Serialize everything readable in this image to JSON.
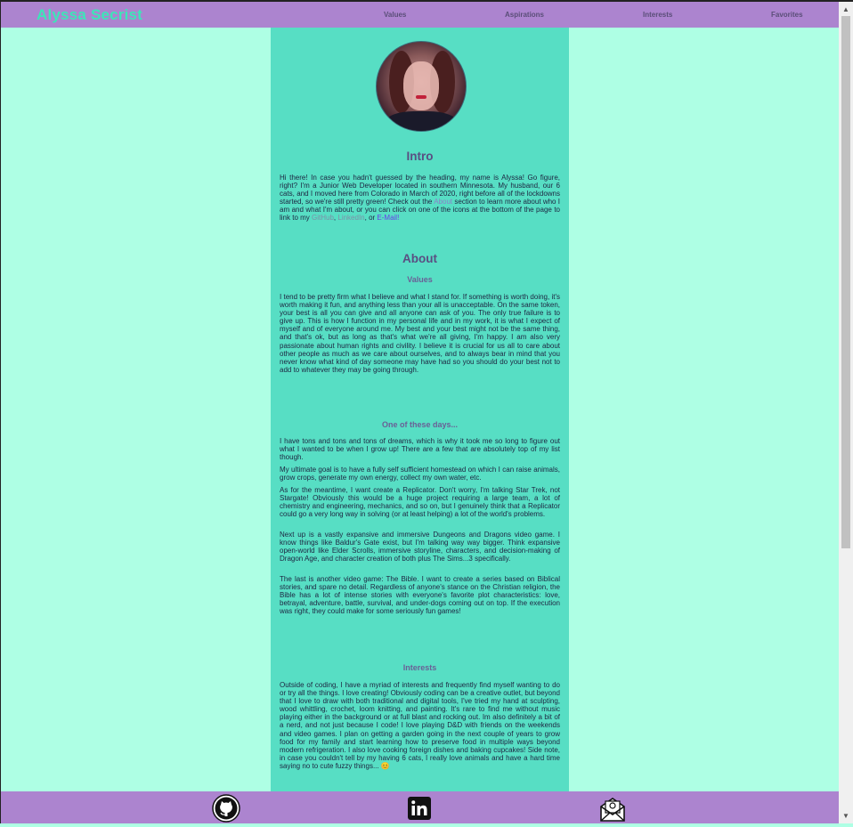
{
  "brand": "Alyssa Secrist",
  "nav": [
    "Values",
    "Aspirations",
    "Interests",
    "Favorites"
  ],
  "intro": {
    "title": "Intro",
    "p1": "Hi there! In case you hadn't guessed by the heading, my name is Alyssa! Go figure, right? I'm a Junior Web Developer located in southern Minnesota. My husband, our 6 cats, and I moved here from Colorado in March of 2020, right before all of the lockdowns started, so we're still pretty green! Check out the ",
    "about_link": "About",
    "p2": " section to learn more about who I am and what I'm about, or you can click on one of the icons at the bottom of the page to link to my ",
    "github_link": "GitHub",
    "comma": ", ",
    "linkedin_link": "LinkedIn",
    "or": ", or ",
    "email_link": "E-Mail!"
  },
  "about": {
    "title": "About",
    "values_title": "Values",
    "values_text": "I tend to be pretty firm what I believe and what I stand for. If something is worth doing, it's worth making it fun, and anything less than your all is unacceptable. On the same token, your best is all you can give and all anyone can ask of you. The only true failure is to give up. This is how I function in my personal life and in my work, it is what I expect of myself and of everyone around me. My best and your best might not be the same thing, and that's ok, but as long as that's what we're all giving, I'm happy. I am also very passionate about human rights and civility. I believe it is crucial for us all to care about other people as much as we care about ourselves, and to always bear in mind that you never know what kind of day someone may have had so you should do your best not to add to whatever they may be going through.",
    "aspirations_title": "One of these days...",
    "asp_p1": "I have tons and tons and tons of dreams, which is why it took me so long to figure out what I wanted to be when I grow up! There are a few that are absolutely top of my list though.",
    "asp_p2": "My ultimate goal is to have a fully self sufficient homestead on which I can raise animals, grow crops, generate my own energy, collect my own water, etc.",
    "asp_p3": "As for the meantime, I want create a Replicator. Don't worry, I'm talking Star Trek, not Stargate! Obviously this would be a huge project requiring a large team, a lot of chemistry and engineering, mechanics, and so on, but I genuinely think that a Replicator could go a very long way in solving (or at least helping) a lot of the world's problems.",
    "asp_p4": "Next up is a vastly expansive and immersive Dungeons and Dragons video game. I know things like Baldur's Gate exist, but I'm talking way way bigger. Think expansive open-world like Elder Scrolls, immersive storyline, characters, and decision-making of Dragon Age, and character creation of both plus The Sims...3 specifically.",
    "asp_p5": "The last is another video game: The Bible. I want to create a series based on Biblical stories, and spare no detail. Regardless of anyone's stance on the Christian religion, the Bible has a lot of intense stories with everyone's favorite plot characteristics: love, betrayal, adventure, battle, survival, and under-dogs coming out on top. If the execution was right, they could make for some seriously fun games!",
    "interests_title": "Interests",
    "interests_text": "Outside of coding, I have a myriad of interests and frequently find myself wanting to do or try all the things. I love creating! Obviously coding can be a creative outlet, but beyond that I love to draw with both traditional and digital tools, I've tried my hand at sculpting, wood whittling, crochet, loom knitting, and painting. It's rare to find me without music playing either in the background or at full blast and rocking out. Im also definitely a bit of a nerd, and not just because I code! I love playing D&D with friends on the weekends and video games. I plan on getting a garden going in the next couple of years to grow food for my family and start learning how to preserve food in multiple ways beyond modern refrigeration. I also love cooking foreign dishes and baking cupcakes! Side note, in case you couldn't tell by my having 6 cats, I really love animals and have a hard time saying no to cute fuzzy things... 😊"
  },
  "footer_icons": [
    "github-icon",
    "linkedin-icon",
    "email-icon"
  ],
  "colors": {
    "page_bg": "#aeffe4",
    "nav_bg": "#ac84cf",
    "content_bg": "#57dec4",
    "brand": "#3ce6b8",
    "heading": "#5a4e82"
  }
}
